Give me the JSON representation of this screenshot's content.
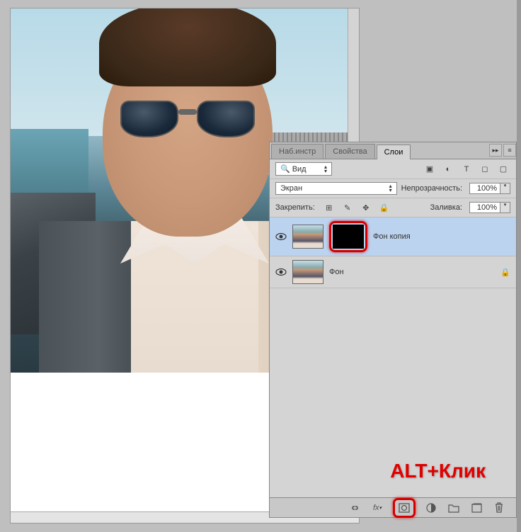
{
  "tabs": {
    "presets": "Наб.инстр",
    "properties": "Свойства",
    "layers": "Слои"
  },
  "filter": {
    "kind": "Вид"
  },
  "blend": {
    "mode": "Экран",
    "opacity_label": "Непрозрачность:",
    "opacity_value": "100%"
  },
  "lock": {
    "label": "Закрепить:",
    "fill_label": "Заливка:",
    "fill_value": "100%"
  },
  "layers": [
    {
      "name": "Фон копия",
      "has_mask": true,
      "locked": false,
      "selected": true
    },
    {
      "name": "Фон",
      "has_mask": false,
      "locked": true,
      "selected": false
    }
  ],
  "annotation": "ALT+Клик",
  "icons": {
    "search": "🔍",
    "image": "▣",
    "adjust": "◐",
    "type": "T",
    "shape": "◻",
    "smart": "▢",
    "pixels": "⊞",
    "position": "✥",
    "lock_all": "🔒",
    "link": "⛓",
    "fx": "fx",
    "mask": "◻",
    "fill_adj": "◑",
    "group": "▢",
    "new": "◻",
    "trash": "🗑"
  }
}
